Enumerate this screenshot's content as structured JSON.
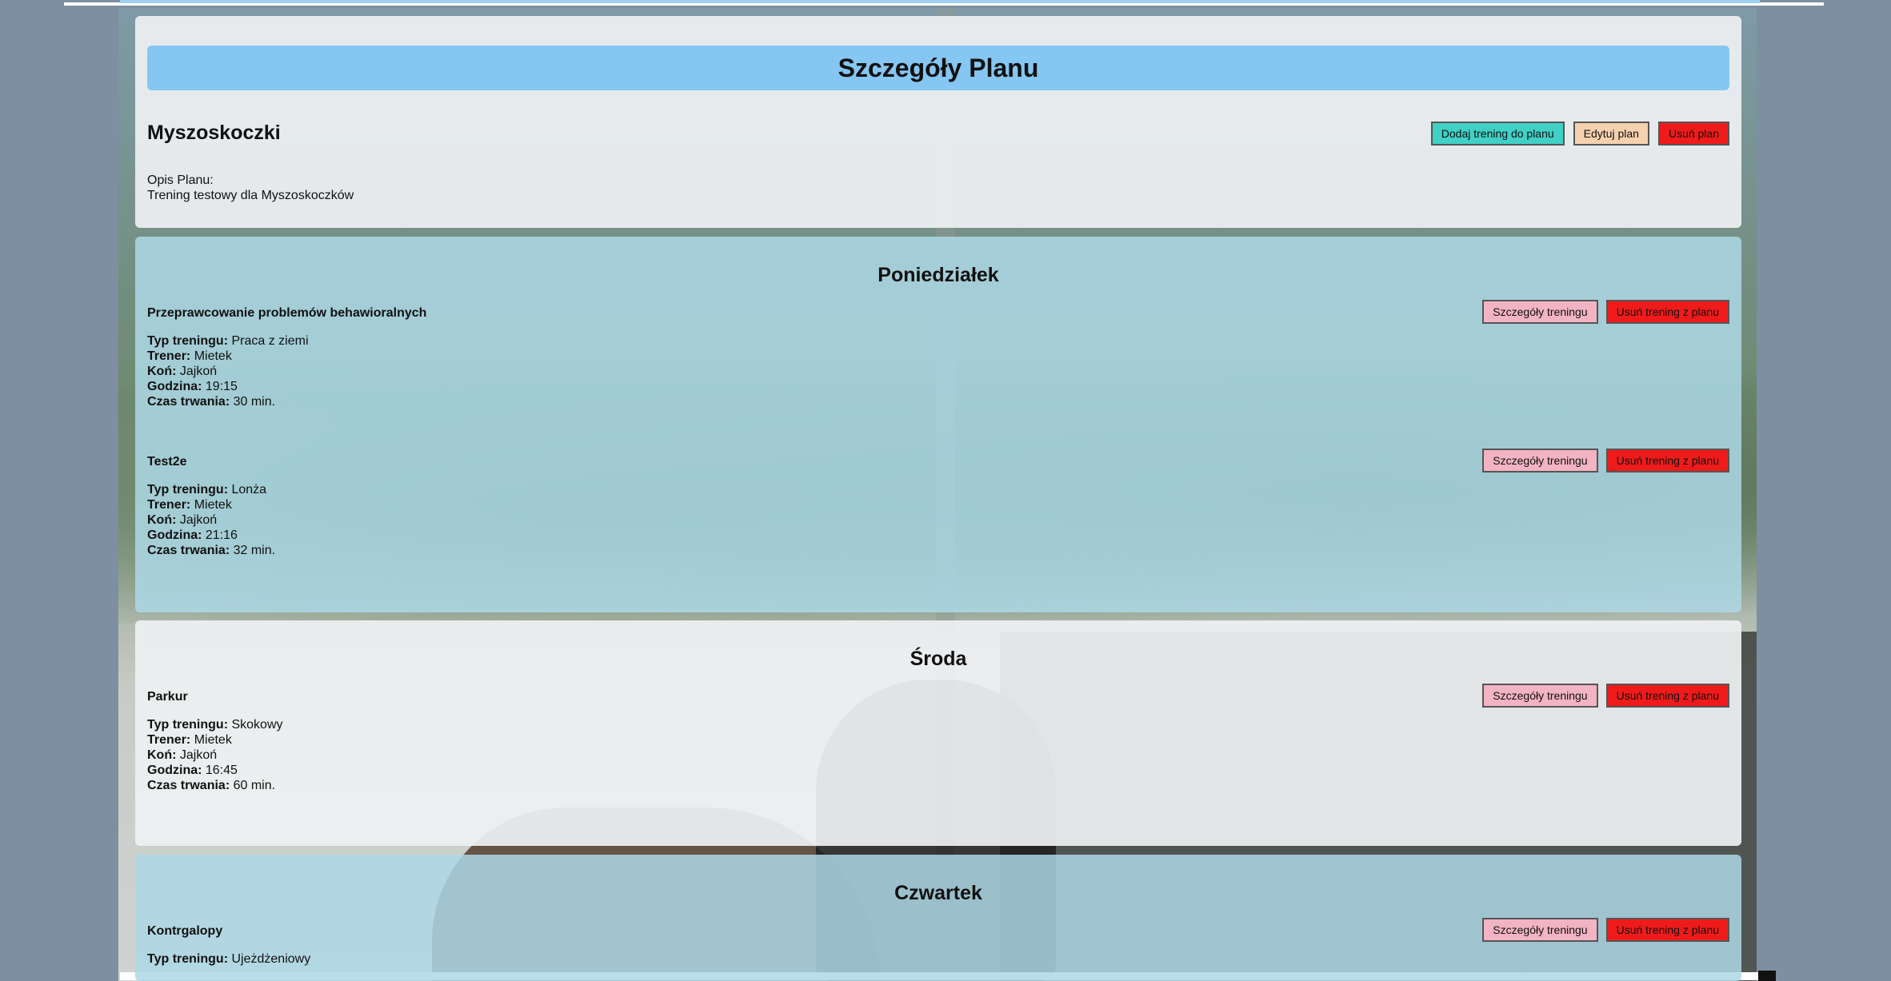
{
  "page_title": "Szczegóły Planu",
  "plan": {
    "name": "Myszoskoczki",
    "description_label": "Opis Planu:",
    "description": "Trening testowy dla Myszoskoczków",
    "actions": {
      "add_training": "Dodaj trening do planu",
      "edit": "Edytuj plan",
      "delete": "Usuń plan"
    }
  },
  "labels": {
    "type": "Typ treningu:",
    "trainer": "Trener:",
    "horse": "Koń:",
    "time": "Godzina:",
    "duration": "Czas trwania:",
    "details_button": "Szczegóły treningu",
    "remove_button": "Usuń trening z planu"
  },
  "days": [
    {
      "name": "Poniedziałek",
      "trainings": [
        {
          "name": "Przeprawcowanie problemów behawioralnych",
          "type": "Praca z ziemi",
          "trainer": "Mietek",
          "horse": "Jajkoń",
          "time": "19:15",
          "duration": "30 min."
        },
        {
          "name": "Test2e",
          "type": "Lonża",
          "trainer": "Mietek",
          "horse": "Jajkoń",
          "time": "21:16",
          "duration": "32 min."
        }
      ]
    },
    {
      "name": "Środa",
      "trainings": [
        {
          "name": "Parkur",
          "type": "Skokowy",
          "trainer": "Mietek",
          "horse": "Jajkoń",
          "time": "16:45",
          "duration": "60 min."
        }
      ]
    },
    {
      "name": "Czwartek",
      "trainings": [
        {
          "name": "Kontrgalopy",
          "type": "Ujeżdżeniowy"
        }
      ]
    }
  ],
  "colors": {
    "title_bar": "#85c6f2",
    "panel_light": "#eef0f2",
    "panel_blue": "#add8e6",
    "btn_teal": "#40d0c6",
    "btn_peach": "#f6d1b0",
    "btn_red": "#ef1b1b",
    "btn_pink": "#f2b3c3"
  }
}
